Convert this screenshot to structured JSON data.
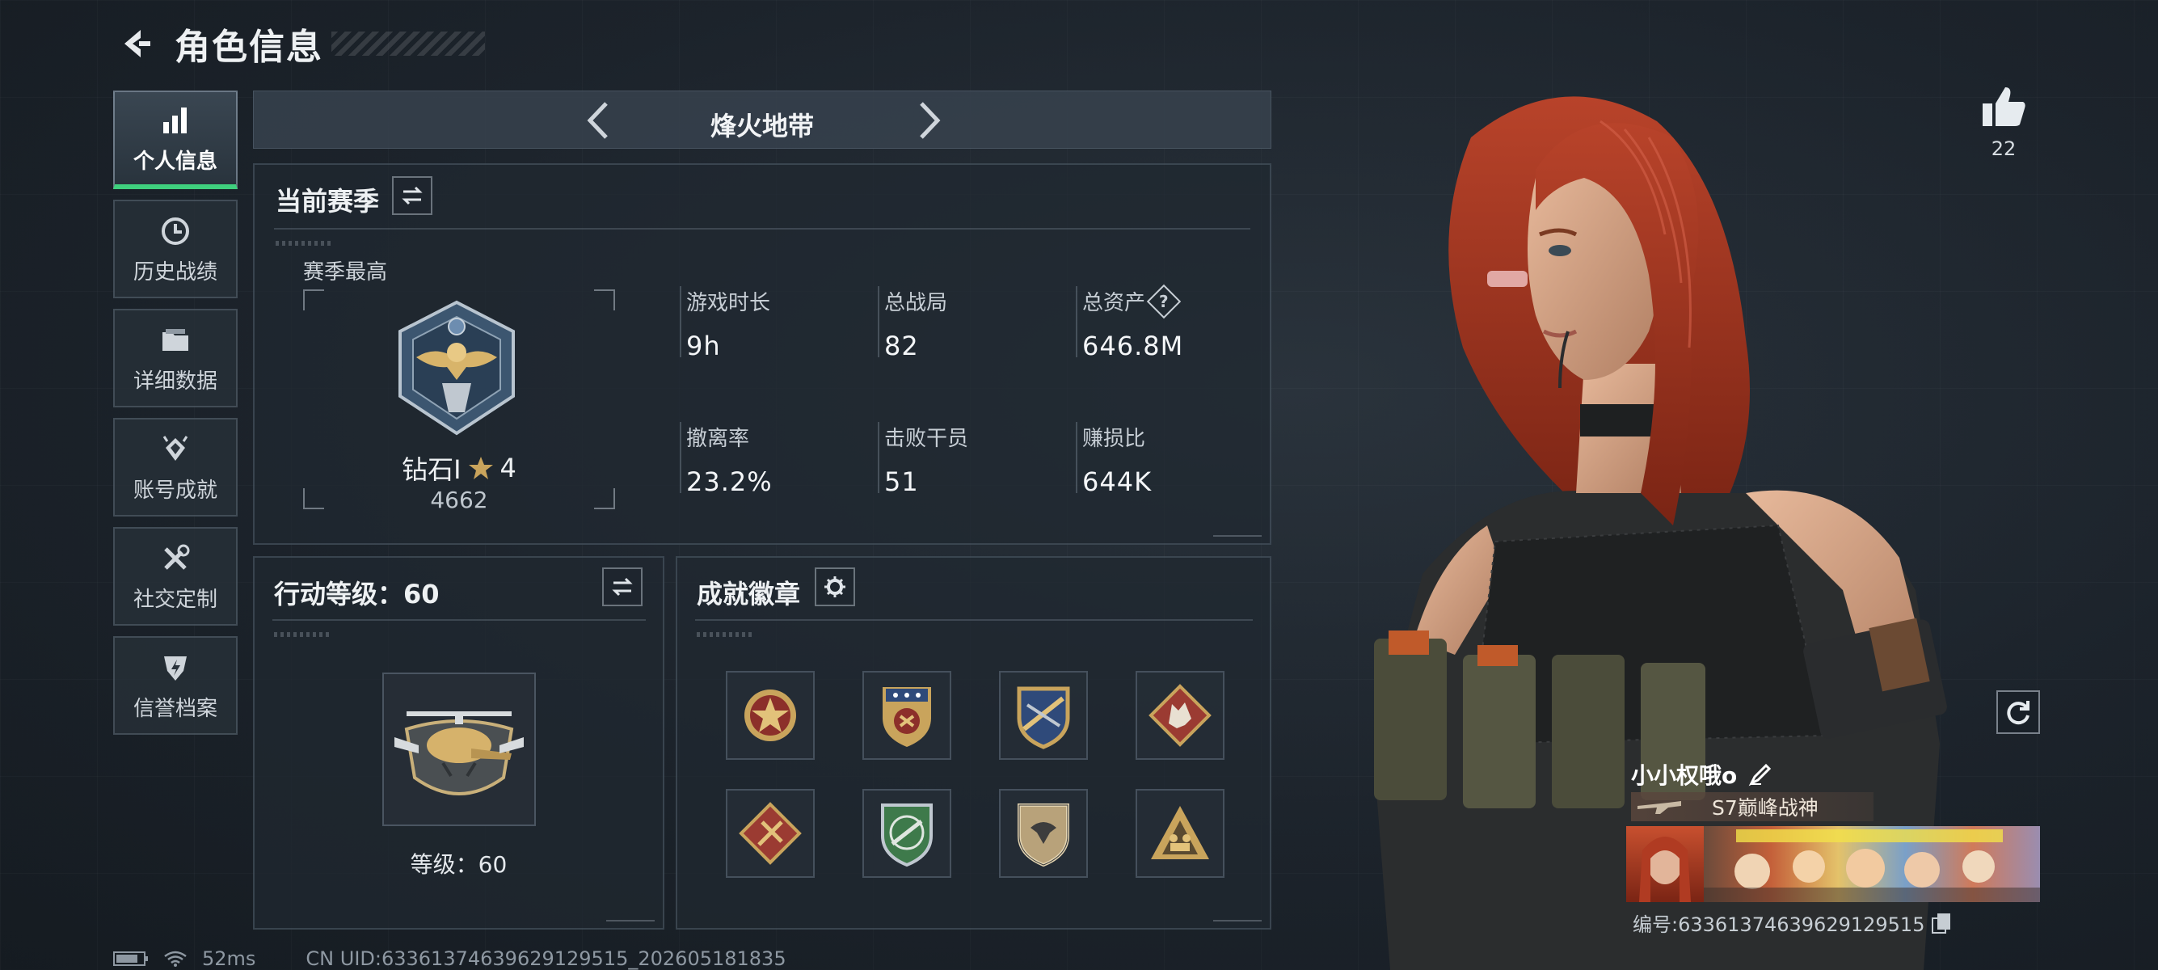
{
  "header": {
    "title": "角色信息"
  },
  "sidebar": {
    "items": [
      {
        "label": "个人信息",
        "icon": "bar-chart-icon",
        "active": true
      },
      {
        "label": "历史战绩",
        "icon": "history-icon",
        "active": false
      },
      {
        "label": "详细数据",
        "icon": "folder-icon",
        "active": false
      },
      {
        "label": "账号成就",
        "icon": "achievement-icon",
        "active": false
      },
      {
        "label": "社交定制",
        "icon": "tools-icon",
        "active": false
      },
      {
        "label": "信誉档案",
        "icon": "shield-icon",
        "active": false
      }
    ]
  },
  "mode": {
    "name": "烽火地带"
  },
  "season": {
    "title": "当前赛季",
    "best_label": "赛季最高",
    "rank_name": "钻石I",
    "rank_stars": "4",
    "rank_score": "4662",
    "stats": [
      {
        "label": "游戏时长",
        "value": "9h"
      },
      {
        "label": "总战局",
        "value": "82"
      },
      {
        "label": "总资产",
        "value": "646.8M",
        "help": "?"
      },
      {
        "label": "撤离率",
        "value": "23.2%"
      },
      {
        "label": "击败干员",
        "value": "51"
      },
      {
        "label": "赚损比",
        "value": "644K"
      }
    ]
  },
  "action_level": {
    "title": "行动等级：60",
    "level_label": "等级：60"
  },
  "badges": {
    "title": "成就徽章",
    "items": [
      "star-medal-icon",
      "stars-shield-icon",
      "rifle-shield-icon",
      "wolf-diamond-icon",
      "cross-diamond-icon",
      "green-gun-badge-icon",
      "bird-shield-icon",
      "triangle-team-icon"
    ],
    "colors": {
      "gold": "#c9a45c",
      "red": "#9b3b32",
      "green": "#3e7a4b"
    }
  },
  "status_bar": {
    "ping": "52ms",
    "uid_line": "CN UID:63361374639629129515_202605181835"
  },
  "profile": {
    "likes": "22",
    "player_name": "小小权哦o",
    "title": "S7巅峰战神",
    "uid": "编号:63361374639629129515"
  },
  "theme": {
    "accent": "#3fd07e",
    "panel": "#202830"
  }
}
